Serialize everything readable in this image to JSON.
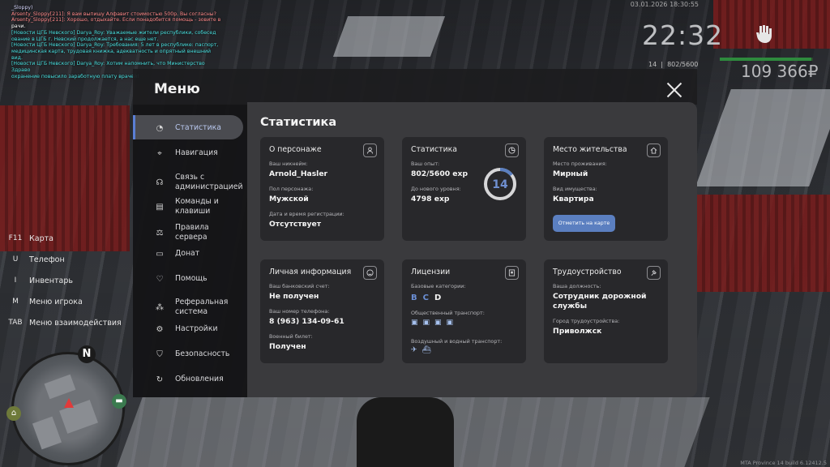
{
  "chat": [
    {
      "text": "_Sloppy)",
      "color": "#d8d8ff"
    },
    {
      "text": "Arsenty_Sloppy[211]: Я вам выпишу Алфавит стоимостью 500р. Вы согласны?",
      "color": "#ff8a8a"
    },
    {
      "text": "Arsenty_Sloppy[211]: Хорошо, отдыхайте. Если понадобится помощь - зовите в",
      "color": "#ff8a8a"
    },
    {
      "text": "рачи.",
      "color": "#ffffff"
    },
    {
      "text": "[Новости ЦГБ Невского] Darya_Roy: Уважаемые жители республики, собесед",
      "color": "#49e0e0"
    },
    {
      "text": "ование в ЦГБ г. Невский продолжается, а нас еще нет.",
      "color": "#49e0e0"
    },
    {
      "text": "[Новости ЦГБ Невского] Darya_Roy: Требования: 5 лет в республике: паспорт,",
      "color": "#49e0e0"
    },
    {
      "text": "медицинская карта, трудовая книжка, адекватность и опрятный внешний вид.",
      "color": "#49e0e0"
    },
    {
      "text": "[Новости ЦГБ Невского] Darya_Roy: Хотим напомнить, что Министерство Здраво",
      "color": "#49e0e0"
    },
    {
      "text": "охранение повысило заработную плату врачей!",
      "color": "#49e0e0"
    }
  ],
  "hud": {
    "datetime": "03.01.2026 18:30:55",
    "clock": "22:32",
    "level": "14",
    "exp": "802/5600",
    "health_fraction": 0.98,
    "money": "109 366₽"
  },
  "keybinds": [
    {
      "key": "F11",
      "label": "Карта"
    },
    {
      "key": "U",
      "label": "Телефон"
    },
    {
      "key": "I",
      "label": "Инвентарь"
    },
    {
      "key": "M",
      "label": "Меню игрока"
    },
    {
      "key": "TAB",
      "label": "Меню взаимодействия"
    }
  ],
  "minimap": {
    "north": "N"
  },
  "watermark": "MTA Province 14 build 6.12412.5",
  "menu": {
    "title": "Меню",
    "nav": [
      {
        "label": "Статистика",
        "icon": "pie-chart-icon"
      },
      {
        "label": "Навигация",
        "icon": "compass-icon"
      },
      {
        "label": "Связь с администрацией",
        "icon": "headset-icon"
      },
      {
        "label": "Команды и клавиши",
        "icon": "document-icon"
      },
      {
        "label": "Правила сервера",
        "icon": "scales-icon"
      },
      {
        "label": "Донат",
        "icon": "wallet-icon"
      },
      {
        "label": "Помощь",
        "icon": "heart-hand-icon"
      },
      {
        "label": "Реферальная система",
        "icon": "network-icon"
      },
      {
        "label": "Настройки",
        "icon": "gear-icon"
      },
      {
        "label": "Безопасность",
        "icon": "shield-icon"
      },
      {
        "label": "Обновления",
        "icon": "refresh-icon"
      }
    ],
    "active_index": 0
  },
  "stats": {
    "title": "Статистика",
    "about": {
      "title": "О персонаже",
      "nick_label": "Ваш никнейм:",
      "nick": "Arnold_Hasler",
      "gender_label": "Пол персонажа:",
      "gender": "Мужской",
      "reg_label": "Дата и время регистрации:",
      "reg": "Отсутствует"
    },
    "statistics": {
      "title": "Статистика",
      "exp_label": "Ваш опыт:",
      "exp": "802/5600 exp",
      "next_label": "До нового уровня:",
      "next": "4798 exp",
      "level": "14",
      "progress": 0.143
    },
    "residence": {
      "title": "Место жительства",
      "place_label": "Место проживания:",
      "place": "Мирный",
      "property_label": "Вид имущества:",
      "property": "Квартира",
      "button": "Отметить на карте"
    },
    "personal": {
      "title": "Личная информация",
      "bank_label": "Ваш банковский счет:",
      "bank": "Не получен",
      "phone_label": "Ваш номер телефона:",
      "phone": "8 (963) 134-09-61",
      "military_label": "Военный билет:",
      "military": "Получен"
    },
    "licenses": {
      "title": "Лицензии",
      "basic_label": "Базовые категории:",
      "categories": [
        {
          "letter": "B",
          "color": "#6b8fd6"
        },
        {
          "letter": "C",
          "color": "#6b8fd6"
        },
        {
          "letter": "D",
          "color": "#f2f2f2"
        }
      ],
      "public_label": "Общественный транспорт:",
      "air_label": "Воздушный и водный транспорт:"
    },
    "employment": {
      "title": "Трудоустройство",
      "position_label": "Ваша должность:",
      "position": "Сотрудник дорожной службы",
      "city_label": "Город трудоустройства:",
      "city": "Приволжск"
    }
  }
}
